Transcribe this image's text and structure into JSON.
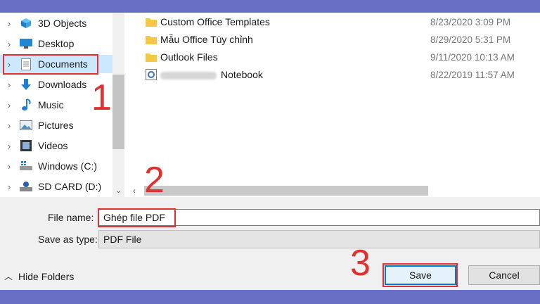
{
  "nav": {
    "items": [
      {
        "label": "3D Objects",
        "icon": "3d-objects-icon"
      },
      {
        "label": "Desktop",
        "icon": "desktop-icon"
      },
      {
        "label": "Documents",
        "icon": "documents-icon",
        "selected": true
      },
      {
        "label": "Downloads",
        "icon": "downloads-icon"
      },
      {
        "label": "Music",
        "icon": "music-icon"
      },
      {
        "label": "Pictures",
        "icon": "pictures-icon"
      },
      {
        "label": "Videos",
        "icon": "videos-icon"
      },
      {
        "label": "Windows (C:)",
        "icon": "drive-icon"
      },
      {
        "label": "SD CARD (D:)",
        "icon": "sd-card-icon"
      }
    ]
  },
  "files": [
    {
      "name": "Custom Office Templates",
      "date": "8/23/2020 3:09 PM",
      "icon": "folder-icon"
    },
    {
      "name": "Mẫu Office Tùy chỉnh",
      "date": "8/29/2020 5:31 PM",
      "icon": "folder-icon"
    },
    {
      "name": "Outlook Files",
      "date": "9/11/2020 10:13 AM",
      "icon": "folder-icon"
    },
    {
      "name": "Notebook",
      "date": "8/22/2019 11:57 AM",
      "icon": "onenote-icon"
    }
  ],
  "form": {
    "file_name_label": "File name:",
    "file_name_value": "Ghép file PDF",
    "save_type_label": "Save as type:",
    "save_type_value": "PDF File"
  },
  "footer": {
    "hide_folders": "Hide Folders",
    "save": "Save",
    "cancel": "Cancel"
  },
  "annotations": {
    "step1": "1",
    "step2": "2",
    "step3": "3"
  },
  "colors": {
    "accent": "#0078d7",
    "selection": "#cce8ff",
    "annotation": "#e03030",
    "outer_background": "#6a6fc6"
  }
}
